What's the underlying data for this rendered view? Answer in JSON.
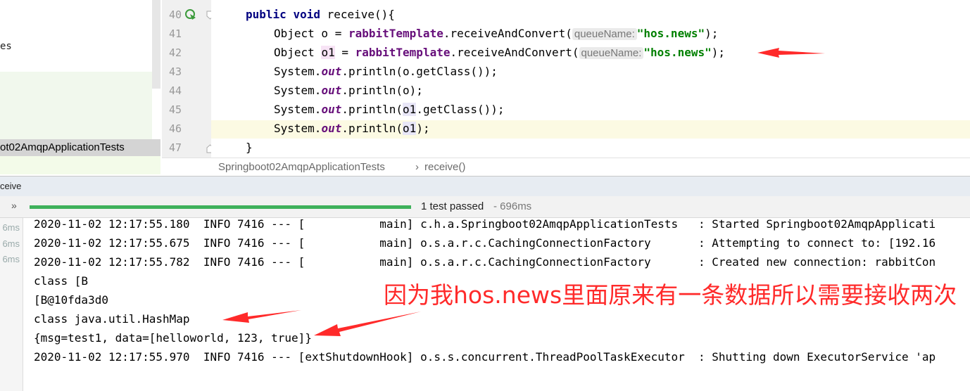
{
  "project_panel": {
    "item_truncated": "es",
    "selected_item": "ot02AmqpApplicationTests"
  },
  "editor": {
    "line_numbers": [
      "40",
      "41",
      "42",
      "43",
      "44",
      "45",
      "46",
      "47"
    ],
    "line40": {
      "kw1": "public",
      "kw2": "void",
      "rest": " receive(){"
    },
    "line41": {
      "pre": "Object o = ",
      "field": "rabbitTemplate",
      "call": ".receiveAndConvert(",
      "hint": "queueName:",
      "str": "\"hos.news\"",
      "post": ");"
    },
    "line42": {
      "pre": "Object ",
      "var": "o1",
      "eq": " = ",
      "field": "rabbitTemplate",
      "call": ".receiveAndConvert(",
      "hint": "queueName:",
      "str": "\"hos.news\"",
      "post": ");"
    },
    "line43": {
      "a": "System.",
      "out": "out",
      "b": ".println(o.getClass());"
    },
    "line44": {
      "a": "System.",
      "out": "out",
      "b": ".println(o);"
    },
    "line45": {
      "a": "System.",
      "out": "out",
      "b": ".println(",
      "v": "o1",
      "c": ".getClass());"
    },
    "line46": {
      "a": "System.",
      "out": "out",
      "b": ".println(",
      "v": "o1",
      "c": ");"
    },
    "line47": "}"
  },
  "breadcrumb": {
    "class": "Springboot02AmqpApplicationTests",
    "sep": "›",
    "method": "receive()"
  },
  "run_panel": {
    "tab_label": "ceive",
    "status": "1 test passed",
    "duration": "- 696ms",
    "expand_icon": "»",
    "left_times": [
      "6ms",
      "6ms",
      "6ms"
    ]
  },
  "console": [
    "2020-11-02 12:17:55.180  INFO 7416 --- [           main] c.h.a.Springboot02AmqpApplicationTests   : Started Springboot02AmqpApplicati",
    "2020-11-02 12:17:55.675  INFO 7416 --- [           main] o.s.a.r.c.CachingConnectionFactory       : Attempting to connect to: [192.16",
    "2020-11-02 12:17:55.782  INFO 7416 --- [           main] o.s.a.r.c.CachingConnectionFactory       : Created new connection: rabbitCon",
    "class [B",
    "[B@10fda3d0",
    "class java.util.HashMap",
    "{msg=test1, data=[helloworld, 123, true]}",
    "2020-11-02 12:17:55.970  INFO 7416 --- [extShutdownHook] o.s.s.concurrent.ThreadPoolTaskExecutor  : Shutting down ExecutorService 'ap"
  ],
  "annotation": "因为我hos.news里面原来有一条数据所以需要接收两次",
  "colors": {
    "keyword": "#000080",
    "field": "#660e7a",
    "string": "#008000",
    "progress": "#3fb15b",
    "annotation": "#ff2a2a"
  }
}
